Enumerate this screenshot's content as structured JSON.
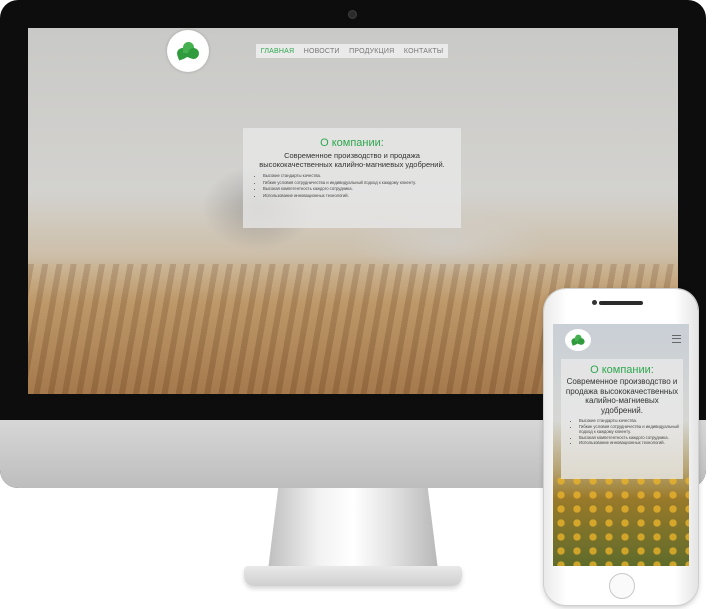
{
  "site": {
    "nav": [
      {
        "label": "ГЛАВНАЯ",
        "active": true
      },
      {
        "label": "НОВОСТИ",
        "active": false
      },
      {
        "label": "ПРОДУКЦИЯ",
        "active": false
      },
      {
        "label": "КОНТАКТЫ",
        "active": false
      }
    ],
    "about": {
      "title": "О компании:",
      "description": "Современное производство и продажа высококачественных калийно-магниевых удобрений.",
      "bullets": [
        "Высокие стандарты качества.",
        "Гибкие условия сотрудничества и индивидуальный подход к каждому клиенту.",
        "Высокая компетентность каждого сотрудника.",
        "Использование инновационных технологий."
      ]
    }
  },
  "colors": {
    "accent": "#2fa84f",
    "bezel": "#0d0d0d"
  },
  "icons": {
    "logo": "green-leaf-logo-icon",
    "menu": "hamburger-menu-icon"
  }
}
